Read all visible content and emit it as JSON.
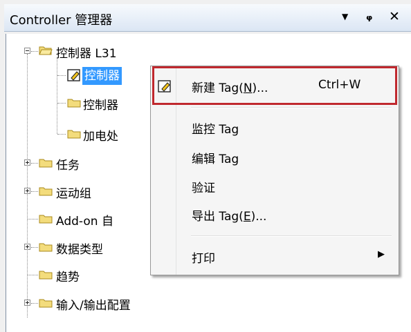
{
  "window": {
    "title": "Controller 管理器",
    "controls": {
      "dropdown": "▼",
      "pin": "ᵩ",
      "close": "✕"
    }
  },
  "tree": {
    "root": "控制器 L31",
    "children_under_root": [
      {
        "label": "控制器",
        "selected": true
      },
      {
        "label": "控制器"
      },
      {
        "label": "加电处"
      }
    ],
    "top_items": [
      {
        "label": "任务",
        "expandable": true
      },
      {
        "label": "运动组",
        "expandable": true
      },
      {
        "label": "Add-on 自",
        "expandable": false
      },
      {
        "label": "数据类型",
        "expandable": true
      },
      {
        "label": "趋势",
        "expandable": false
      },
      {
        "label": "输入/输出配置",
        "expandable": true
      }
    ]
  },
  "context_menu": {
    "items": [
      {
        "label": "新建 Tag(N)...",
        "underline_char": "N",
        "shortcut": "Ctrl+W",
        "icon": "new-tag-icon"
      },
      {
        "label": "监控 Tag"
      },
      {
        "label": "编辑 Tag"
      },
      {
        "label": "验证"
      },
      {
        "label": "导出 Tag(E)...",
        "underline_char": "E"
      },
      {
        "label": "打印",
        "submenu": true
      }
    ]
  },
  "colors": {
    "highlight_border": "#c0282e",
    "selection": "#3399ff",
    "folder": "#f3dc7c"
  }
}
